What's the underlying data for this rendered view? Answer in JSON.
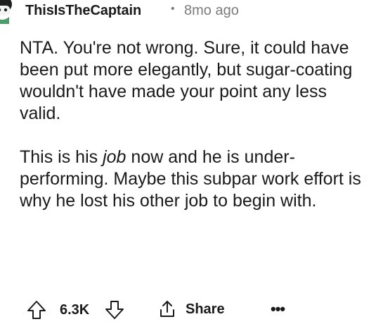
{
  "comment": {
    "author": "ThisIsTheCaptain",
    "separator": "•",
    "timestamp": "8mo ago",
    "paragraphs": [
      {
        "text": "NTA. You're not wrong. Sure, it could have been put more elegantly, but sugar-coating wouldn't have made your point any less valid."
      },
      {
        "before": "This is his ",
        "emphasis": "job",
        "after": " now and he is under-performing. Maybe this subpar work effort is why he lost his other job to begin with."
      }
    ]
  },
  "actions": {
    "vote_count": "6.3K",
    "share_label": "Share",
    "more_label": "•••",
    "icons": {
      "upvote": "upvote-arrow-icon",
      "downvote": "downvote-arrow-icon",
      "share": "share-icon",
      "more": "more-options-icon"
    }
  },
  "colors": {
    "text": "#1a1a1b",
    "meta": "#7c7c7c",
    "icon_stroke": "#1a1a1b"
  }
}
